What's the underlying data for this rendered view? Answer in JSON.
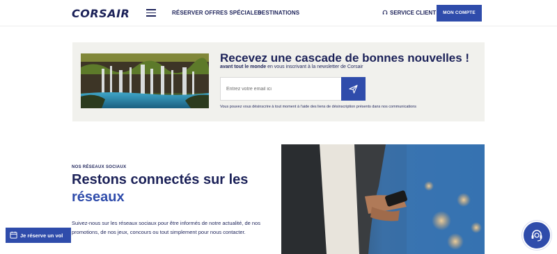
{
  "header": {
    "logo": "CORSAIR",
    "nav": [
      "RÉSERVER",
      "OFFRES SPÉCIALES",
      "DESTINATIONS"
    ],
    "service_client": "SERVICE CLIENT",
    "account_button": "MON COMPTE"
  },
  "newsletter": {
    "title": "Recevez une cascade de bonnes nouvelles !",
    "subtitle_bold": "avant tout le monde",
    "subtitle_rest": " en vous inscrivant à la newsletter de Corsair",
    "email_placeholder": "Entrez votre email ici",
    "legal": "Vous pouvez vous désinscrire à tout moment à l'aide des liens de désinscription présents dans nos communications"
  },
  "social": {
    "eyebrow": "NOS RÉSEAUX SOCIAUX",
    "heading_main": "Restons connectés sur les ",
    "heading_accent": "réseaux",
    "paragraph": "Suivez-nous sur les réseaux sociaux pour être informés de notre actualité, de nos promotions, de nos jeux, concours ou tout simplement pour nous contacter."
  },
  "floating": {
    "book_button": "Je réserve un vol"
  },
  "colors": {
    "navy": "#1b2158",
    "brand_blue": "#2f4cab",
    "panel_bg": "#f1f1ed"
  },
  "icons": [
    "menu-icon",
    "headset-icon",
    "send-icon",
    "calendar-icon",
    "support-agent-icon"
  ]
}
